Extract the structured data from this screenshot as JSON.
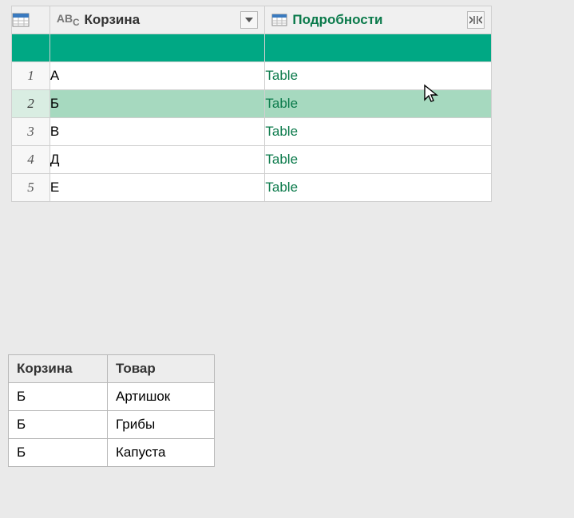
{
  "colors": {
    "accent": "#00a884",
    "linkGreen": "#0b7a4b",
    "headerBg": "#f0f0f0",
    "selectedRow": "#a6d9bf"
  },
  "mainTable": {
    "columns": {
      "korzina": {
        "label": "Корзина",
        "typePrefix": "AB",
        "typeSub": "C"
      },
      "podrobnosti": {
        "label": "Подробности"
      }
    },
    "rows": [
      {
        "n": "1",
        "korzina": "А",
        "podrob": "Table",
        "selected": false
      },
      {
        "n": "2",
        "korzina": "Б",
        "podrob": "Table",
        "selected": true
      },
      {
        "n": "3",
        "korzina": "В",
        "podrob": "Table",
        "selected": false
      },
      {
        "n": "4",
        "korzina": "Д",
        "podrob": "Table",
        "selected": false
      },
      {
        "n": "5",
        "korzina": "Е",
        "podrob": "Table",
        "selected": false
      }
    ]
  },
  "previewTable": {
    "headers": {
      "c1": "Корзина",
      "c2": "Товар"
    },
    "rows": [
      {
        "c1": "Б",
        "c2": "Артишок"
      },
      {
        "c1": "Б",
        "c2": "Грибы"
      },
      {
        "c1": "Б",
        "c2": "Капуста"
      }
    ]
  }
}
